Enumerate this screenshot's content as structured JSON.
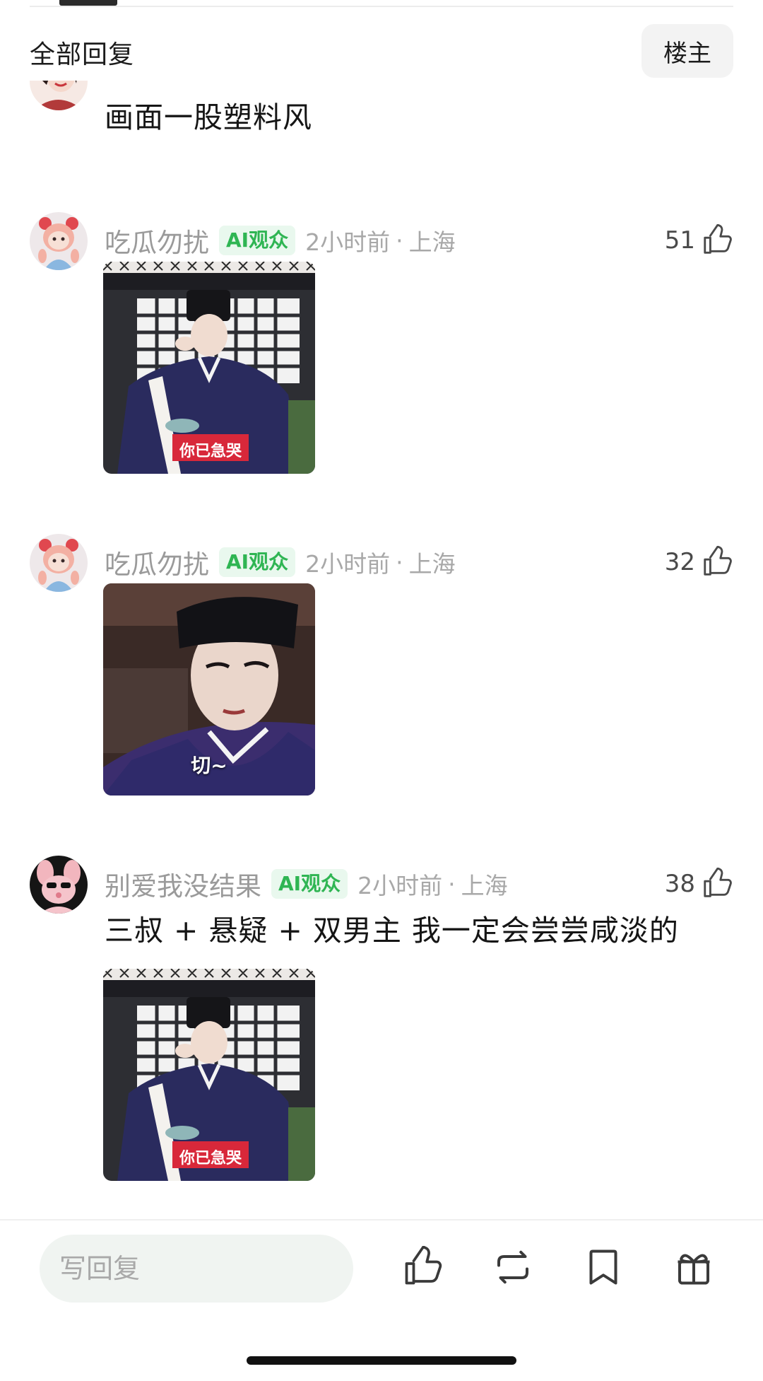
{
  "header": {
    "title": "全部回复",
    "op_filter_label": "楼主"
  },
  "comments": [
    {
      "partial": true,
      "text": "画面一股塑料风"
    },
    {
      "user": "吃瓜勿扰",
      "badge": "AI观众",
      "time": "2小时前",
      "location": "上海",
      "likes": "51",
      "image_caption": "你已急哭"
    },
    {
      "user": "吃瓜勿扰",
      "badge": "AI观众",
      "time": "2小时前",
      "location": "上海",
      "likes": "32",
      "image_caption": "切~"
    },
    {
      "user": "别爱我没结果",
      "badge": "AI观众",
      "time": "2小时前",
      "location": "上海",
      "likes": "38",
      "text": "三叔 + 悬疑 + 双男主 我一定会尝尝咸淡的",
      "image_caption": "你已急哭"
    }
  ],
  "bottom_bar": {
    "reply_placeholder": "写回复",
    "icons": [
      "like-icon",
      "repost-icon",
      "bookmark-icon",
      "gift-icon"
    ]
  },
  "colors": {
    "badge_green": "#2fb553",
    "badge_bg": "#e9f8ee",
    "caption_red": "#d8283a",
    "robe_navy": "#2a2b5e"
  }
}
